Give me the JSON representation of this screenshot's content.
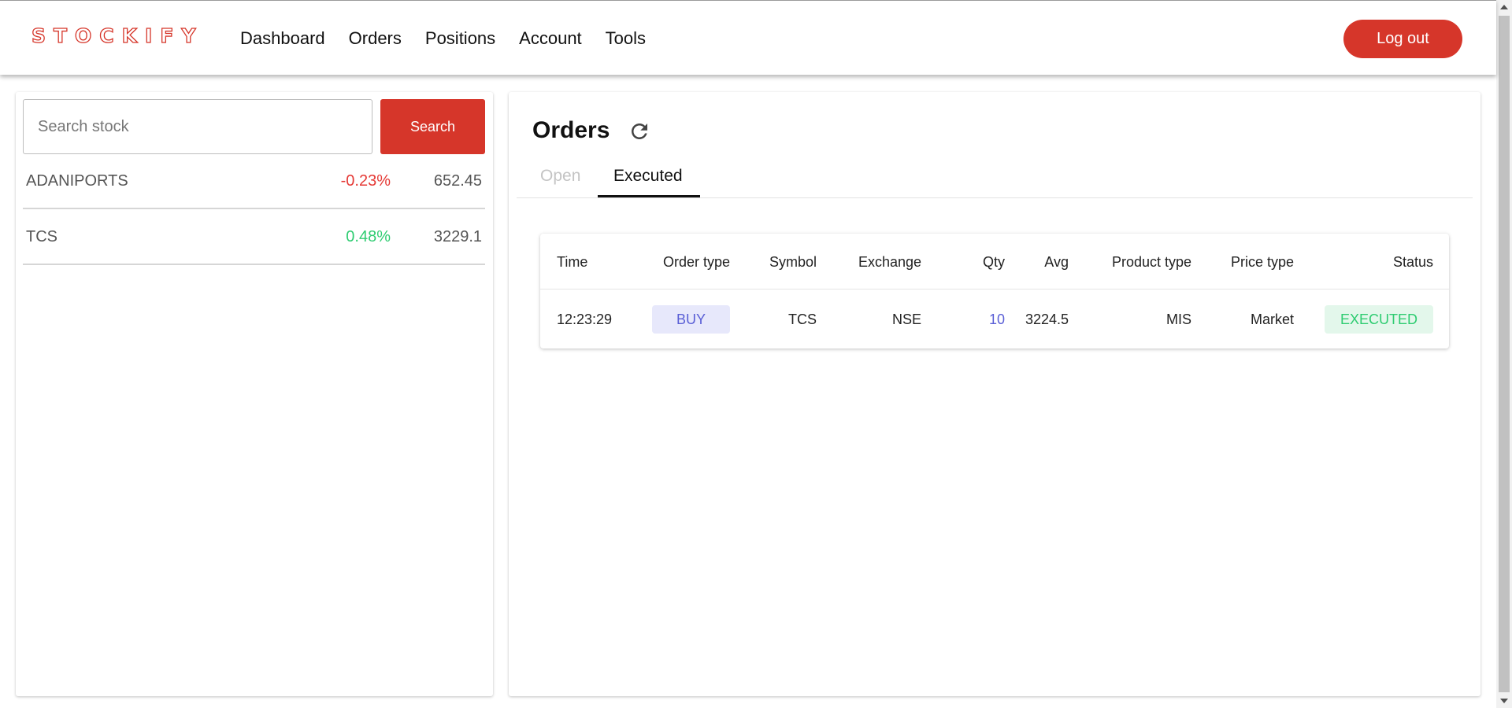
{
  "header": {
    "logo": "STOCKIFY",
    "nav": [
      "Dashboard",
      "Orders",
      "Positions",
      "Account",
      "Tools"
    ],
    "logout_label": "Log out"
  },
  "search": {
    "placeholder": "Search stock",
    "button_label": "Search"
  },
  "watchlist": [
    {
      "symbol": "ADANIPORTS",
      "change": "-0.23%",
      "price": "652.45",
      "direction": "down"
    },
    {
      "symbol": "TCS",
      "change": "0.48%",
      "price": "3229.1",
      "direction": "up"
    }
  ],
  "orders": {
    "title": "Orders",
    "refresh_icon": "refresh-icon",
    "tabs": [
      {
        "label": "Open",
        "active": false
      },
      {
        "label": "Executed",
        "active": true
      }
    ],
    "columns": [
      "Time",
      "Order type",
      "Symbol",
      "Exchange",
      "Qty",
      "Avg",
      "Product type",
      "Price type",
      "Status"
    ],
    "rows": [
      {
        "time": "12:23:29",
        "order_type": "BUY",
        "symbol": "TCS",
        "exchange": "NSE",
        "qty": "10",
        "avg": "3224.5",
        "product_type": "MIS",
        "price_type": "Market",
        "status": "EXECUTED"
      }
    ]
  },
  "colors": {
    "brand": "#d6362a",
    "negative": "#e53935",
    "positive": "#2ecc71",
    "buy": "#5a5fd6"
  }
}
